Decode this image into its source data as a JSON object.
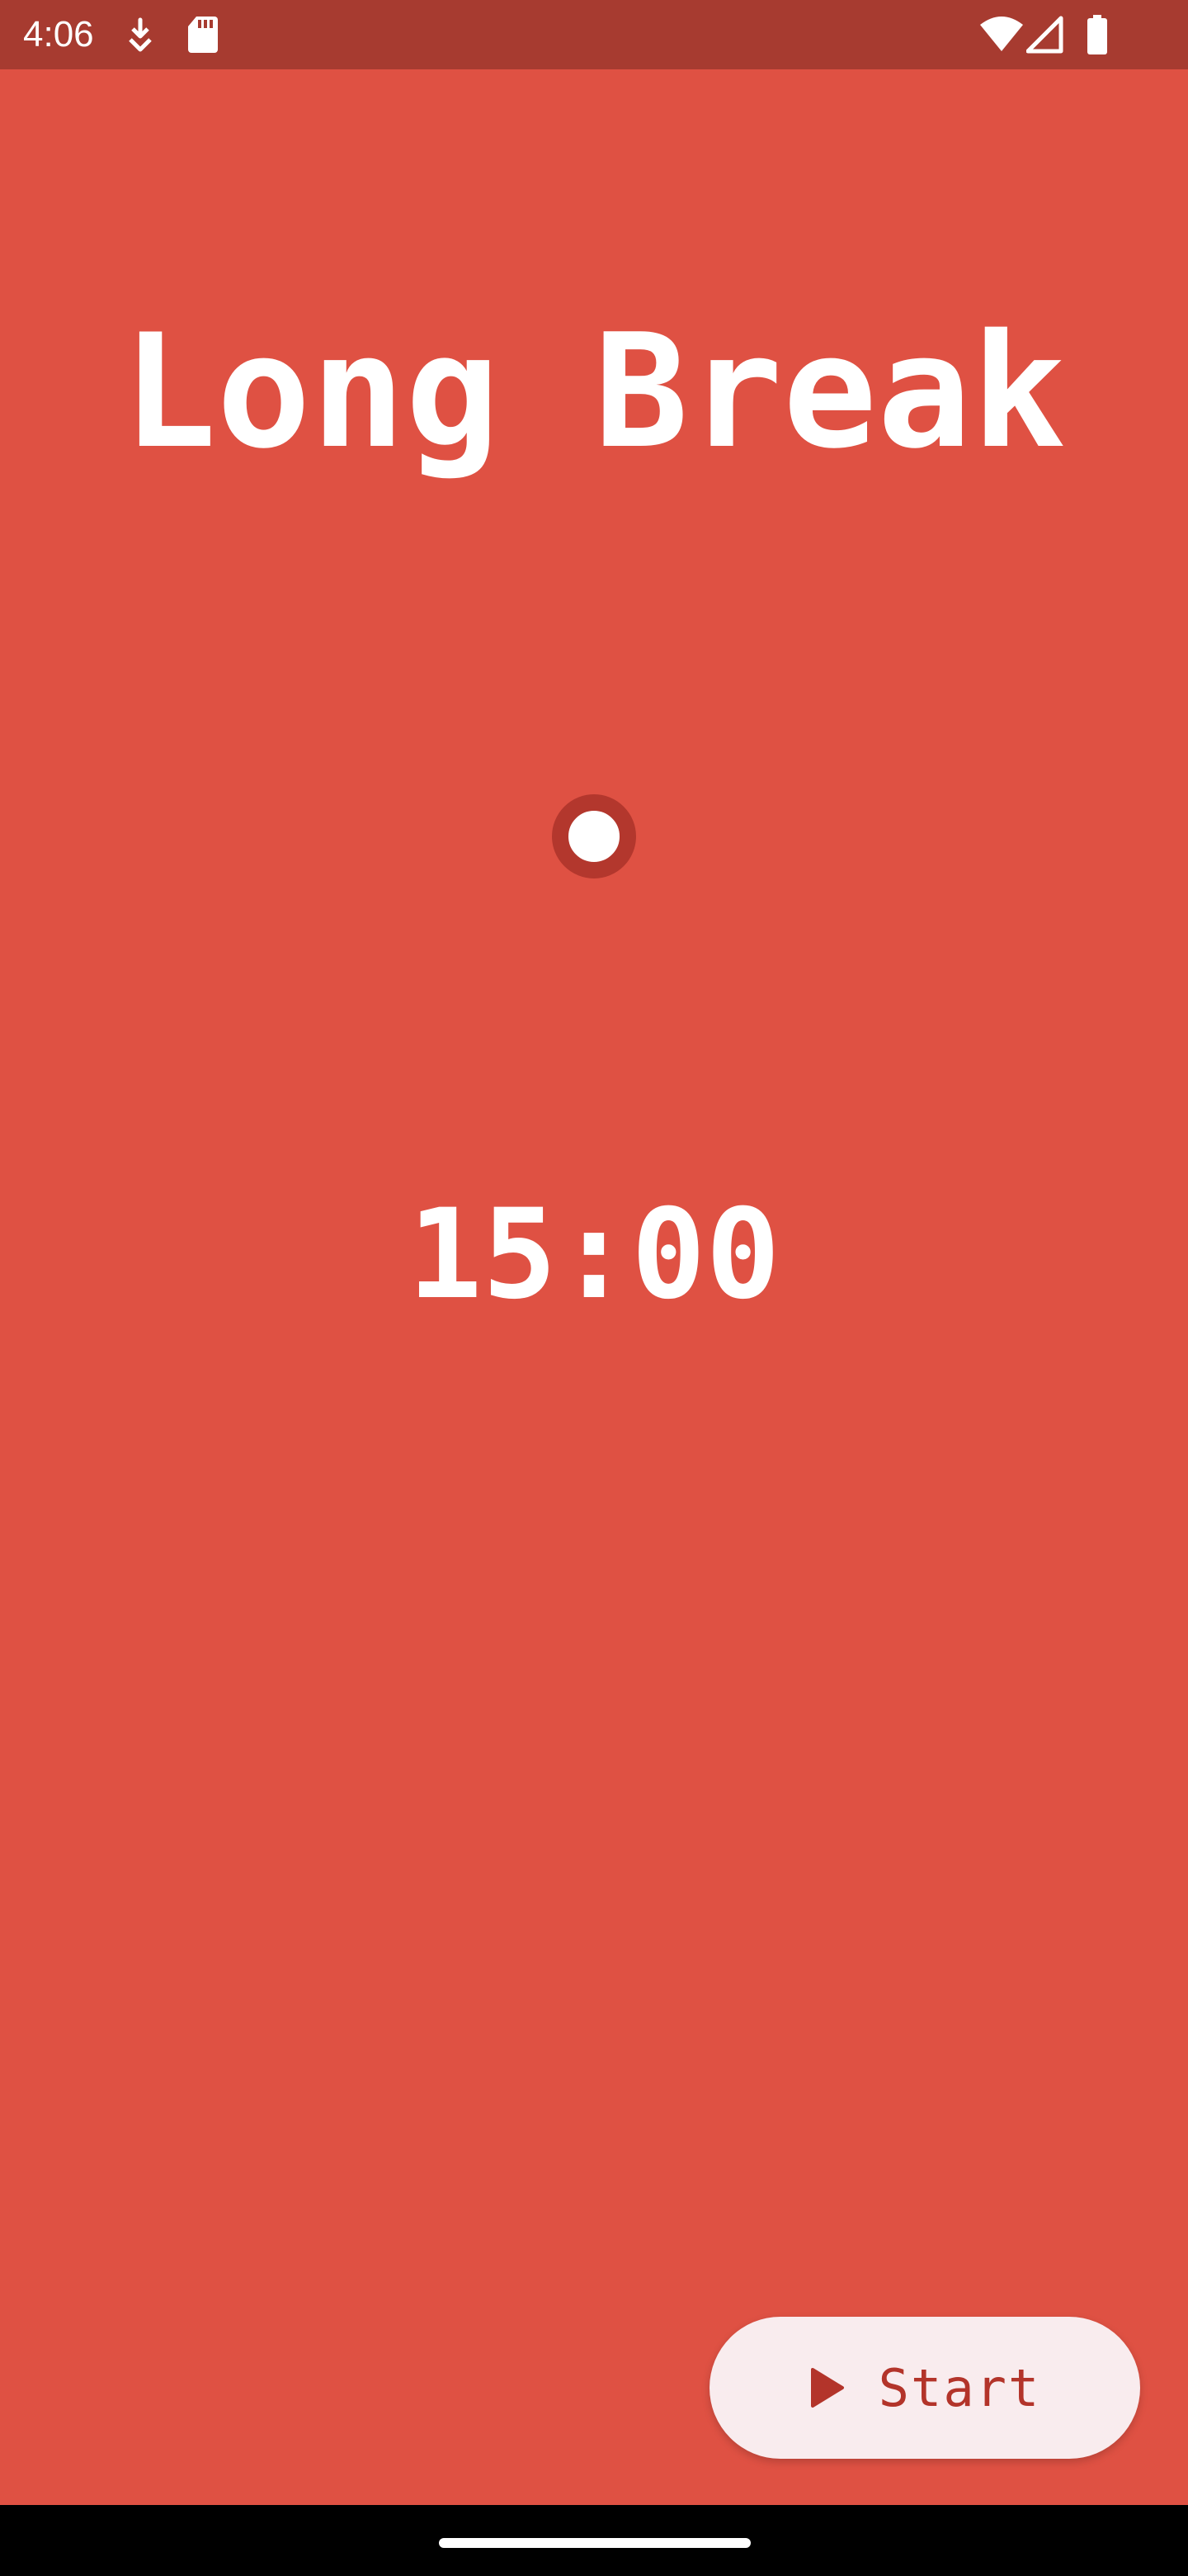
{
  "status_bar": {
    "time": "4:06",
    "background_color": "#a73b30",
    "left_icons": [
      "download-icon",
      "sd-card-icon"
    ],
    "right_icons": [
      "wifi-icon",
      "cellular-signal-icon",
      "battery-icon"
    ]
  },
  "screen": {
    "title": "Long Break",
    "background_color": "#df5143"
  },
  "progress": {
    "dot_count": 1,
    "fill_color": "#ffffff",
    "ring_color": "#b3372d"
  },
  "timer": {
    "value": "15:00"
  },
  "start_button": {
    "label": "Start",
    "icon": "play-icon",
    "background_color": "#f9ecee",
    "text_color": "#b3342a"
  },
  "nav_bar": {
    "icon": "home-handle"
  }
}
